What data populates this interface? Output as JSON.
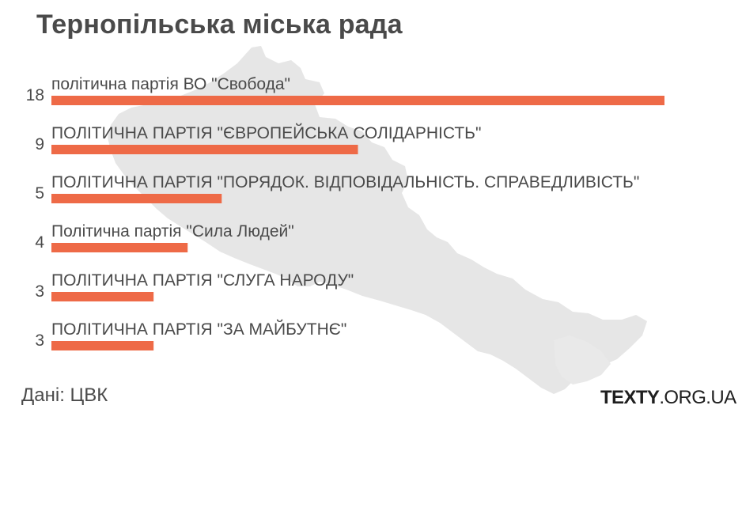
{
  "title": "Тернопільська міська рада",
  "source": "Дані: ЦВК",
  "brand": {
    "name_bold": "TEXTY",
    "name_rest": ".ORG.UA"
  },
  "colors": {
    "bar": "#ee6a47",
    "label_text": "#4a4a4a",
    "map_silhouette": "#e6e6e6"
  },
  "chart_data": {
    "type": "bar",
    "orientation": "horizontal",
    "categories": [
      "політична партія ВО \"Свобода\"",
      "ПОЛІТИЧНА ПАРТІЯ \"ЄВРОПЕЙСЬКА СОЛІДАРНІСТЬ\"",
      "ПОЛІТИЧНА ПАРТІЯ \"ПОРЯДОК. ВІДПОВІДАЛЬНІСТЬ. СПРАВЕДЛИВІСТЬ\"",
      "Політична партія \"Сила Людей\"",
      "ПОЛІТИЧНА ПАРТІЯ \"СЛУГА НАРОДУ\"",
      "ПОЛІТИЧНА ПАРТІЯ \"ЗА МАЙБУТНЄ\""
    ],
    "values": [
      18,
      9,
      5,
      4,
      3,
      3
    ],
    "data_labels": [
      "18",
      "9",
      "5",
      "4",
      "3",
      "3"
    ],
    "xlim": [
      0,
      18
    ],
    "grid": false,
    "legend": "none"
  }
}
